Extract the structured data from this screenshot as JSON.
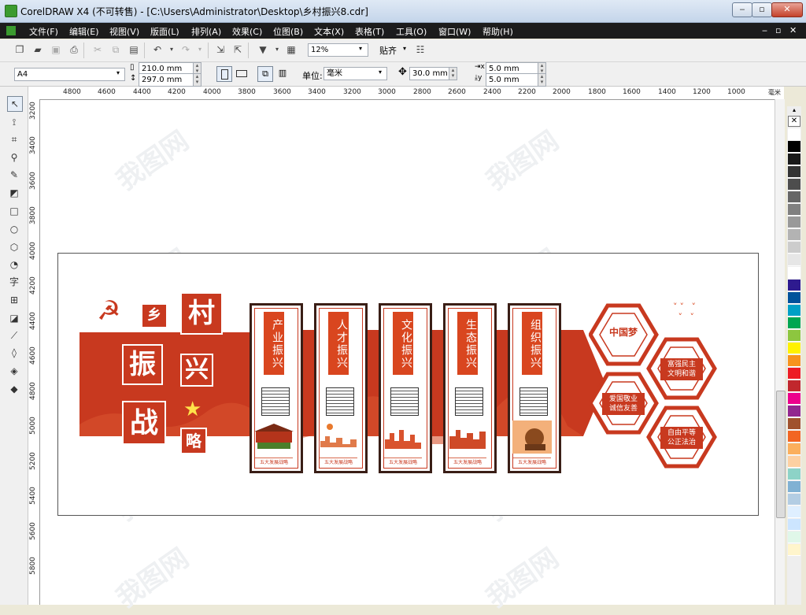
{
  "window": {
    "title": "CorelDRAW X4 (不可转售) - [C:\\Users\\Administrator\\Desktop\\乡村振兴8.cdr]",
    "min": "‒",
    "max": "▫",
    "close": "✕"
  },
  "menu": [
    "文件(F)",
    "编辑(E)",
    "视图(V)",
    "版面(L)",
    "排列(A)",
    "效果(C)",
    "位图(B)",
    "文本(X)",
    "表格(T)",
    "工具(O)",
    "窗口(W)",
    "帮助(H)"
  ],
  "toolbar": {
    "zoom": "12%",
    "snap": "贴齐"
  },
  "property_bar": {
    "paper": "A4",
    "width": "210.0 mm",
    "height": "297.0 mm",
    "units_label": "单位:",
    "units": "毫米",
    "nudge": "30.0 mm",
    "dup_x": "5.0 mm",
    "dup_y": "5.0 mm"
  },
  "ruler": {
    "top_ticks": [
      "4800",
      "4600",
      "4400",
      "4200",
      "4000",
      "3800",
      "3600",
      "3400",
      "3200",
      "3000",
      "2800",
      "2600",
      "2400",
      "2200",
      "2000",
      "1800",
      "1600",
      "1400",
      "1200",
      "1000"
    ],
    "top_unit": "毫米",
    "left_ticks": [
      "3200",
      "3400",
      "3600",
      "3800",
      "4000",
      "4200",
      "4400",
      "4600",
      "4800",
      "5000",
      "5200",
      "5400",
      "5600",
      "5800"
    ]
  },
  "artwork": {
    "chars": {
      "xiang": "乡",
      "cun": "村",
      "zhen": "振",
      "xing": "兴",
      "zhan": "战",
      "lue": "略"
    },
    "panels": [
      {
        "title": "产业振兴",
        "footer": "五大发展战略"
      },
      {
        "title": "人才振兴",
        "footer": "五大发展战略"
      },
      {
        "title": "文化振兴",
        "footer": "五大发展战略"
      },
      {
        "title": "生态振兴",
        "footer": "五大发展战略"
      },
      {
        "title": "组织振兴",
        "footer": "五大发展战略"
      }
    ],
    "hex": {
      "china_dream": "中国梦",
      "h2_line1": "富强民主",
      "h2_line2": "文明和谐",
      "h3_line1": "爱国敬业",
      "h3_line2": "诚信友善",
      "h4_line1": "自由平等",
      "h4_line2": "公正法治"
    },
    "colors": {
      "primary": "#c8391f",
      "dark": "#3a1e16"
    }
  },
  "palette": [
    "#ffffff",
    "#000000",
    "#1a1a1a",
    "#333333",
    "#4d4d4d",
    "#666666",
    "#808080",
    "#999999",
    "#b3b3b3",
    "#cccccc",
    "#e6e6e6",
    "#ffffff",
    "#2e1a8f",
    "#00529b",
    "#00a0c6",
    "#00a651",
    "#8dc63f",
    "#fff200",
    "#f7941d",
    "#ed1c24",
    "#c1272d",
    "#ec008c",
    "#92278f",
    "#a0522d",
    "#f26522",
    "#fbaf5d",
    "#fdd0a2",
    "#8dd3c7",
    "#80b1d3",
    "#b3cde3",
    "#dfefff",
    "#cce5ff",
    "#e0f7e9",
    "#fff5cc"
  ]
}
